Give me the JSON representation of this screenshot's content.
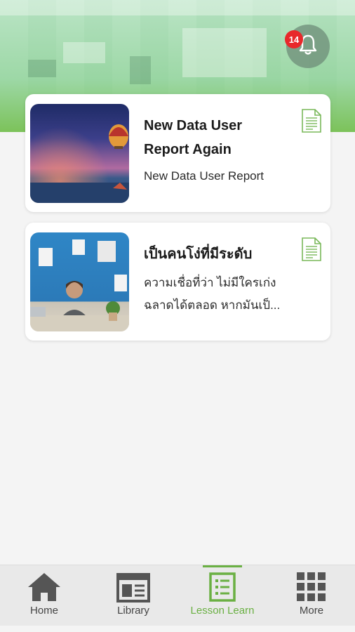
{
  "header": {
    "notification_count": "14",
    "bell_icon": "bell-icon"
  },
  "cards": [
    {
      "title_line1": "New Data User",
      "title_line2": "Report Again",
      "subtitle": "New Data User Report",
      "thumbnail": "sunset-balloon-image",
      "icon": "document-icon"
    },
    {
      "title_line1": "เป็นคนโง่ที่มีระดับ",
      "subtitle_line1": "ความเชื่อที่ว่า ไม่มีใครเก่ง",
      "subtitle_line2": "ฉลาดได้ตลอด หากมันเป็...",
      "thumbnail": "stressed-man-image",
      "icon": "document-icon"
    }
  ],
  "tabbar": {
    "tabs": [
      {
        "label": "Home",
        "icon": "home-icon",
        "active": false
      },
      {
        "label": "Library",
        "icon": "library-icon",
        "active": false
      },
      {
        "label": "Lesson Learn",
        "icon": "lesson-icon",
        "active": true
      },
      {
        "label": "More",
        "icon": "grid-icon",
        "active": false
      }
    ],
    "active_color": "#6ab043"
  }
}
